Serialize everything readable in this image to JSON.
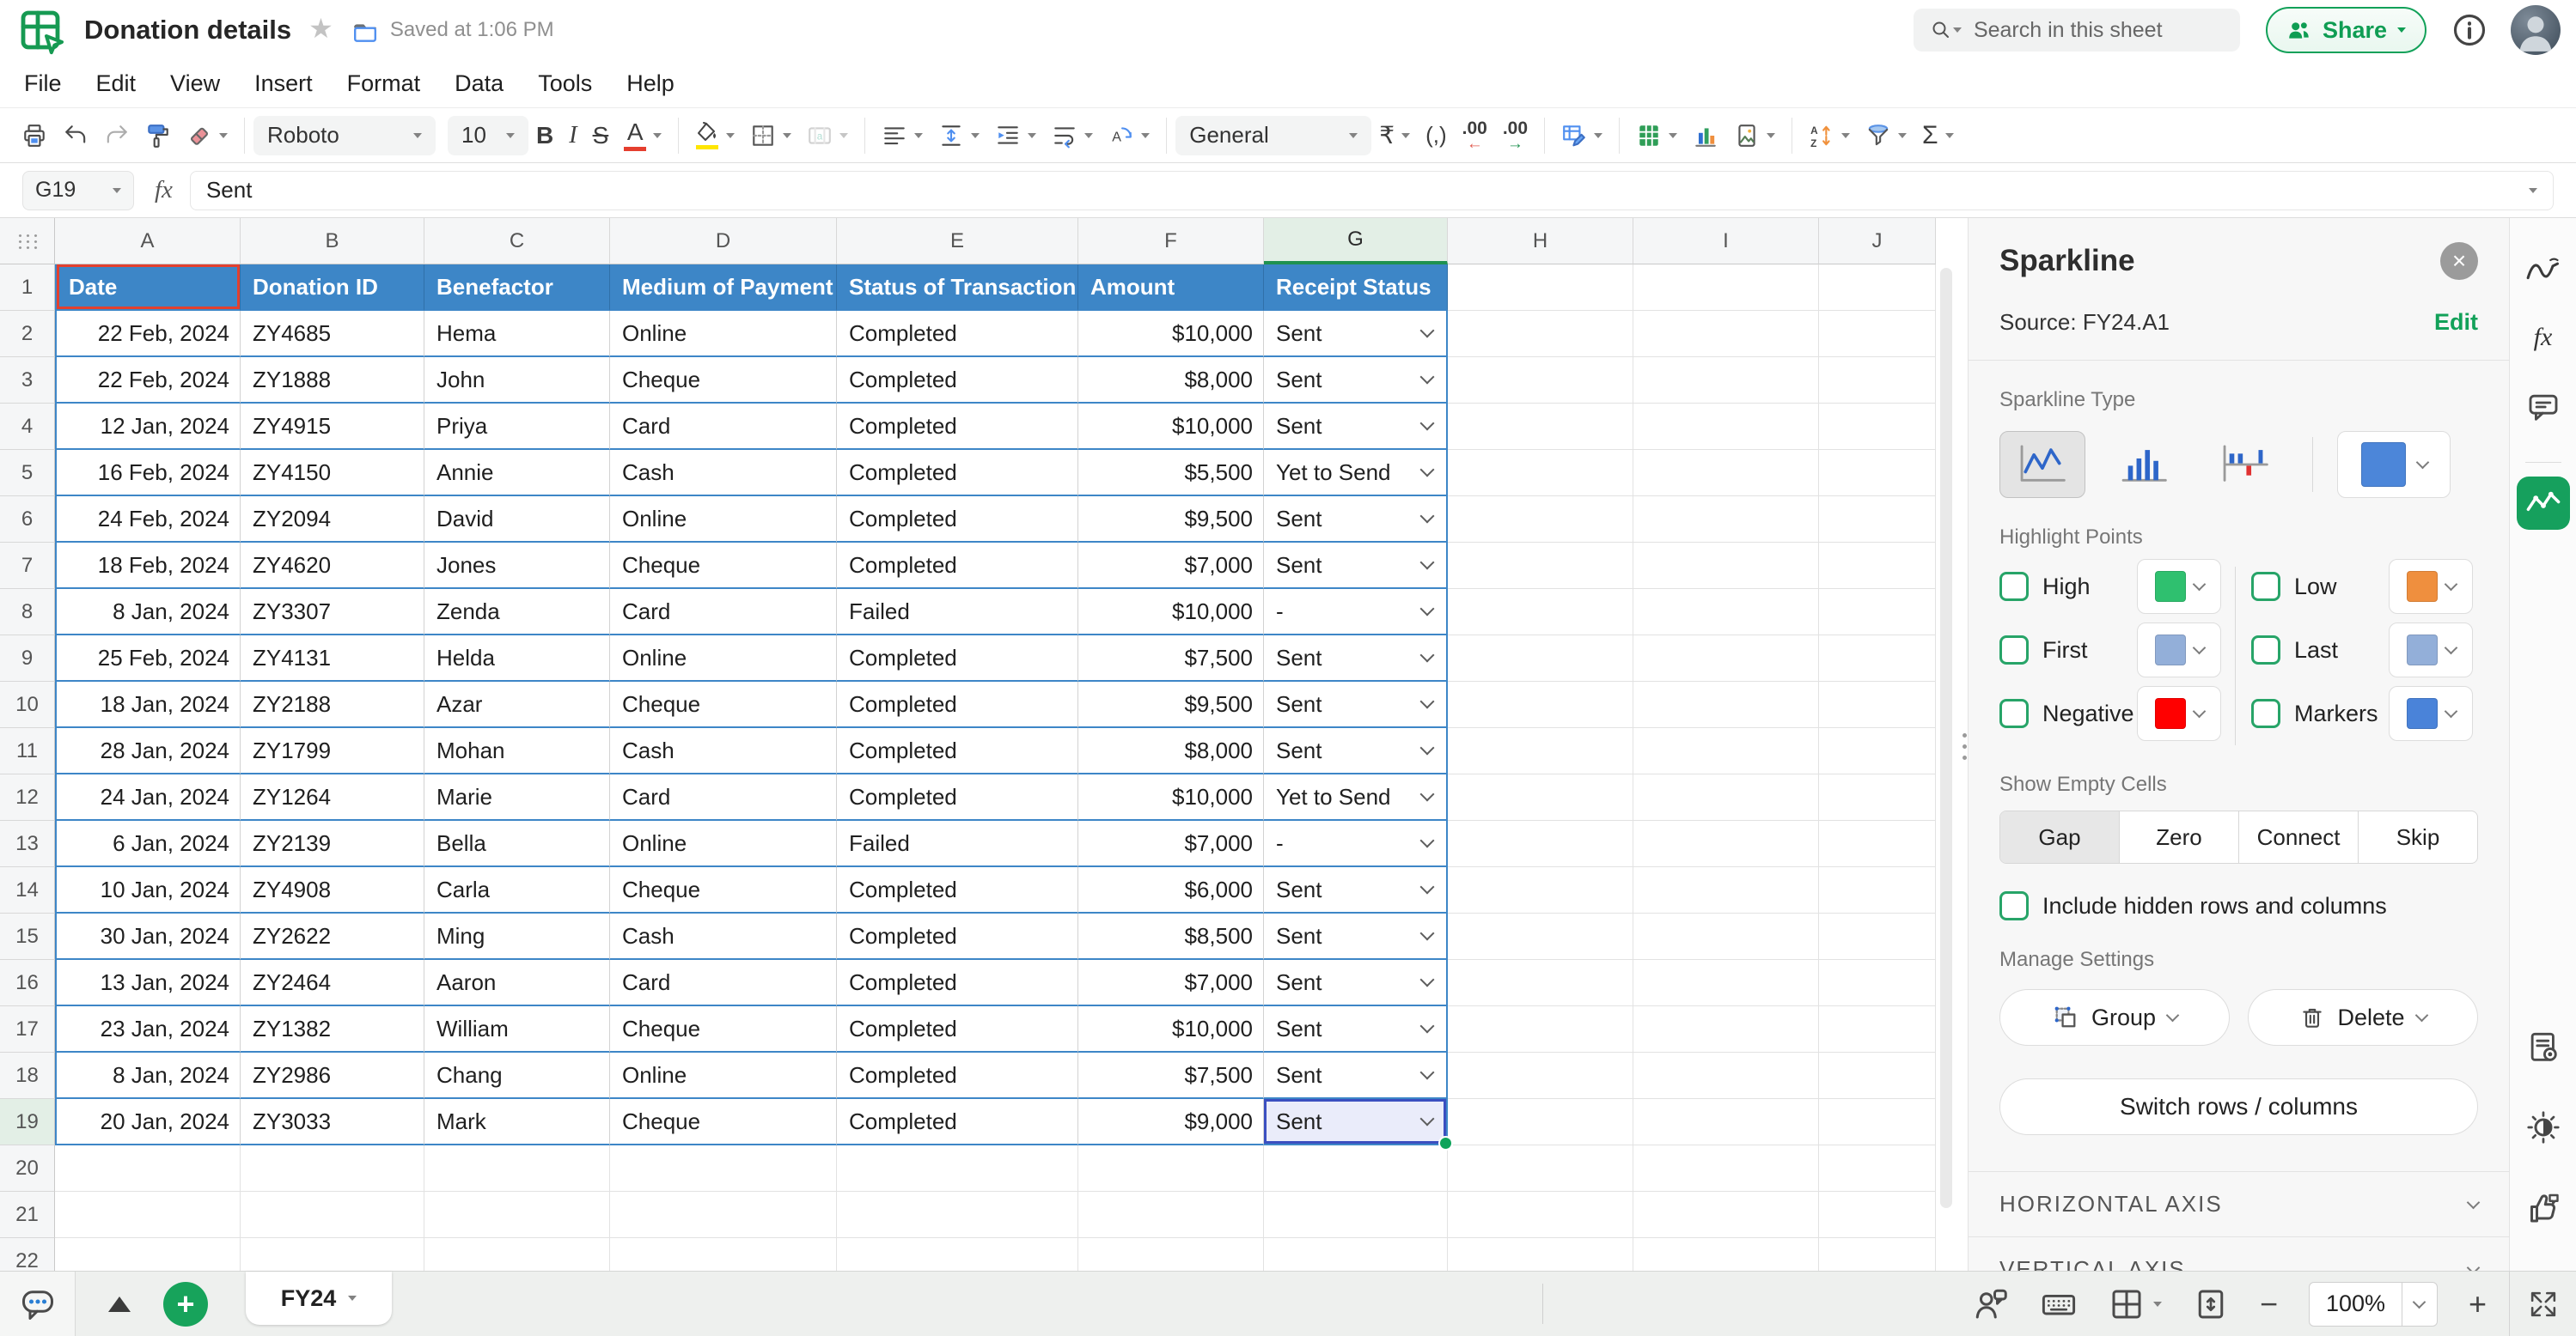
{
  "header": {
    "title": "Donation details",
    "saved": "Saved at 1:06 PM",
    "search_placeholder": "Search in this sheet",
    "share_label": "Share"
  },
  "menu": {
    "items": [
      "File",
      "Edit",
      "View",
      "Insert",
      "Format",
      "Data",
      "Tools",
      "Help"
    ]
  },
  "toolbar": {
    "font_name": "Roboto",
    "font_size": "10",
    "bold_label": "B",
    "italic_label": "I",
    "strike_label": "S",
    "text_color_label": "A",
    "number_format": "General",
    "currency_label": "₹",
    "comma_label": "(,)",
    "decimal_decrease": ".00",
    "decimal_increase": ".00",
    "sum_label": "Σ"
  },
  "formula_bar": {
    "cell_ref": "G19",
    "fx_label": "fx",
    "value": "Sent"
  },
  "grid": {
    "columns": [
      "A",
      "B",
      "C",
      "D",
      "E",
      "F",
      "G",
      "H",
      "I",
      "J"
    ],
    "header_row": [
      "Date",
      "Donation ID",
      "Benefactor",
      "Medium of Payment",
      "Status of Transaction",
      "Amount",
      "Receipt Status"
    ],
    "rows": [
      {
        "date": "22 Feb, 2024",
        "id": "ZY4685",
        "benefactor": "Hema",
        "medium": "Online",
        "status": "Completed",
        "amount": "$10,000",
        "receipt": "Sent"
      },
      {
        "date": "22 Feb, 2024",
        "id": "ZY1888",
        "benefactor": "John",
        "medium": "Cheque",
        "status": "Completed",
        "amount": "$8,000",
        "receipt": "Sent"
      },
      {
        "date": "12 Jan, 2024",
        "id": "ZY4915",
        "benefactor": "Priya",
        "medium": "Card",
        "status": "Completed",
        "amount": "$10,000",
        "receipt": "Sent"
      },
      {
        "date": "16 Feb, 2024",
        "id": "ZY4150",
        "benefactor": "Annie",
        "medium": "Cash",
        "status": "Completed",
        "amount": "$5,500",
        "receipt": "Yet to Send"
      },
      {
        "date": "24 Feb, 2024",
        "id": "ZY2094",
        "benefactor": "David",
        "medium": "Online",
        "status": "Completed",
        "amount": "$9,500",
        "receipt": "Sent"
      },
      {
        "date": "18 Feb, 2024",
        "id": "ZY4620",
        "benefactor": "Jones",
        "medium": "Cheque",
        "status": "Completed",
        "amount": "$7,000",
        "receipt": "Sent"
      },
      {
        "date": "8 Jan, 2024",
        "id": "ZY3307",
        "benefactor": "Zenda",
        "medium": "Card",
        "status": "Failed",
        "amount": "$10,000",
        "receipt": "-"
      },
      {
        "date": "25 Feb, 2024",
        "id": "ZY4131",
        "benefactor": "Helda",
        "medium": "Online",
        "status": "Completed",
        "amount": "$7,500",
        "receipt": "Sent"
      },
      {
        "date": "18 Jan, 2024",
        "id": "ZY2188",
        "benefactor": "Azar",
        "medium": "Cheque",
        "status": "Completed",
        "amount": "$9,500",
        "receipt": "Sent"
      },
      {
        "date": "28 Jan, 2024",
        "id": "ZY1799",
        "benefactor": "Mohan",
        "medium": "Cash",
        "status": "Completed",
        "amount": "$8,000",
        "receipt": "Sent"
      },
      {
        "date": "24 Jan, 2024",
        "id": "ZY1264",
        "benefactor": "Marie",
        "medium": "Card",
        "status": "Completed",
        "amount": "$10,000",
        "receipt": "Yet to Send"
      },
      {
        "date": "6 Jan, 2024",
        "id": "ZY2139",
        "benefactor": "Bella",
        "medium": "Online",
        "status": "Failed",
        "amount": "$7,000",
        "receipt": "-"
      },
      {
        "date": "10 Jan, 2024",
        "id": "ZY4908",
        "benefactor": "Carla",
        "medium": "Cheque",
        "status": "Completed",
        "amount": "$6,000",
        "receipt": "Sent"
      },
      {
        "date": "30 Jan, 2024",
        "id": "ZY2622",
        "benefactor": "Ming",
        "medium": "Cash",
        "status": "Completed",
        "amount": "$8,500",
        "receipt": "Sent"
      },
      {
        "date": "13 Jan, 2024",
        "id": "ZY2464",
        "benefactor": "Aaron",
        "medium": "Card",
        "status": "Completed",
        "amount": "$7,000",
        "receipt": "Sent"
      },
      {
        "date": "23 Jan, 2024",
        "id": "ZY1382",
        "benefactor": "William",
        "medium": "Cheque",
        "status": "Completed",
        "amount": "$10,000",
        "receipt": "Sent"
      },
      {
        "date": "8 Jan, 2024",
        "id": "ZY2986",
        "benefactor": "Chang",
        "medium": "Online",
        "status": "Completed",
        "amount": "$7,500",
        "receipt": "Sent"
      },
      {
        "date": "20 Jan, 2024",
        "id": "ZY3033",
        "benefactor": "Mark",
        "medium": "Cheque",
        "status": "Completed",
        "amount": "$9,000",
        "receipt": "Sent"
      }
    ],
    "selected_cell": "G19",
    "selected_column": "G",
    "selected_row": 19,
    "source_highlight_cell": "A1"
  },
  "panel": {
    "title": "Sparkline",
    "source": "Source: FY24.A1",
    "edit_label": "Edit",
    "type_label": "Sparkline Type",
    "sparkline_color": "#4c86d9",
    "highlight_label": "Highlight Points",
    "highlights": [
      {
        "label": "High",
        "color": "#2fc06f"
      },
      {
        "label": "Low",
        "color": "#ef8f3e"
      },
      {
        "label": "First",
        "color": "#93afd9"
      },
      {
        "label": "Last",
        "color": "#93afd9"
      },
      {
        "label": "Negative",
        "color": "#ff0000"
      },
      {
        "label": "Markers",
        "color": "#4a83d9"
      }
    ],
    "empty_label": "Show Empty Cells",
    "empty_options": [
      "Gap",
      "Zero",
      "Connect",
      "Skip"
    ],
    "empty_selected": "Gap",
    "include_hidden_label": "Include hidden rows and columns",
    "manage_label": "Manage Settings",
    "group_label": "Group",
    "delete_label": "Delete",
    "switch_label": "Switch rows / columns",
    "sections": [
      "HORIZONTAL AXIS",
      "VERTICAL AXIS"
    ]
  },
  "tabs": {
    "active_tab": "FY24"
  },
  "statusbar": {
    "zoom_level": "100%"
  },
  "colors": {
    "table_header_blue": "#3d86c7",
    "brand_green": "#0f9d53",
    "selected_cell_border": "#3b4fc0",
    "source_highlight_red": "#e2402f",
    "selected_header_green": "#e3efe6"
  }
}
